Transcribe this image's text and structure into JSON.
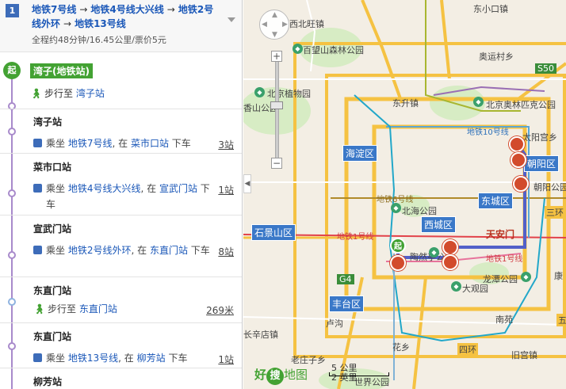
{
  "route": {
    "number": "1",
    "lines": [
      "地铁7号线",
      "地铁4号线大兴线",
      "地铁2号线外环",
      "地铁13号线"
    ],
    "arrow": "→",
    "summary": "全程约48分钟/16.45公里/票价5元"
  },
  "steps": {
    "start_badge": "起",
    "start_name": "湾子(地铁站)",
    "walk1_prefix": "步行至",
    "walk1_dest": "湾子站",
    "items": [
      {
        "title": "湾子站",
        "pre": "乘坐",
        "line": "地铁7号线",
        "mid": ", 在",
        "stop": "菜市口站",
        "post": "下车",
        "count": "3站"
      },
      {
        "title": "菜市口站",
        "pre": "乘坐",
        "line": "地铁4号线大兴线",
        "mid": ", 在",
        "stop": "宣武门站",
        "post": "下车",
        "count": "1站"
      },
      {
        "title": "宣武门站",
        "pre": "乘坐",
        "line": "地铁2号线外环",
        "mid": ", 在",
        "stop": "东直门站",
        "post": "下车",
        "count": "8站"
      },
      {
        "title": "东直门站",
        "walk_prefix": "步行至",
        "walk_dest": "东直门站",
        "count": "269米"
      },
      {
        "title": "东直门站",
        "pre": "乘坐",
        "line": "地铁13号线",
        "mid": ", 在",
        "stop": "柳芳站",
        "post": "下车",
        "count": "1站"
      },
      {
        "title": "柳芳站"
      }
    ]
  },
  "map": {
    "labels": {
      "xibeiwang": "西北旺镇",
      "dongxiaokou": "东小口镇",
      "baiwangshan": "百望山森林公园",
      "xiangshan": "香山公园",
      "aoyuncun": "奥运村乡",
      "botanical": "北京植物园",
      "dongsheng": "东升镇",
      "olympic": "北京奥林匹克公园",
      "s50": "S50",
      "subway10": "地铁10号线",
      "taiyanggong": "太阳宫乡",
      "chaoyang_park": "朝阳公园",
      "subway6": "地铁6号线",
      "beihai": "北海公园",
      "subway1": "地铁1号线",
      "tiananmen": "天安门",
      "subway1_2": "地铁1号线",
      "taoranting": "陶然亭公园",
      "longtan": "龙潭公园",
      "daguanyuan": "大观园",
      "g4": "G4",
      "fengtai": "丰台区",
      "lugu": "卢沟",
      "sanhuan": "三环",
      "huaxiang": "花乡",
      "sihuan": "四环",
      "laozhuangzi": "老庄子乡",
      "jiugong": "旧宫镇",
      "nanyuan": "南苑",
      "shijie": "世界公园",
      "changping": "长辛店镇",
      "kuan": "康",
      "wuyuan": "五环"
    },
    "districts": {
      "haidian": "海淀区",
      "chaoyang": "朝阳区",
      "dongcheng": "东城区",
      "xicheng": "西城区",
      "shijingshan": "石景山区"
    },
    "controls": {
      "zoom_in": "+",
      "zoom_out": "−",
      "collapse": "◀"
    },
    "logo": {
      "hao": "好",
      "sou": "搜",
      "ditu": "地图"
    },
    "scale": {
      "km": "5 公里",
      "mi": "2 英里"
    }
  }
}
